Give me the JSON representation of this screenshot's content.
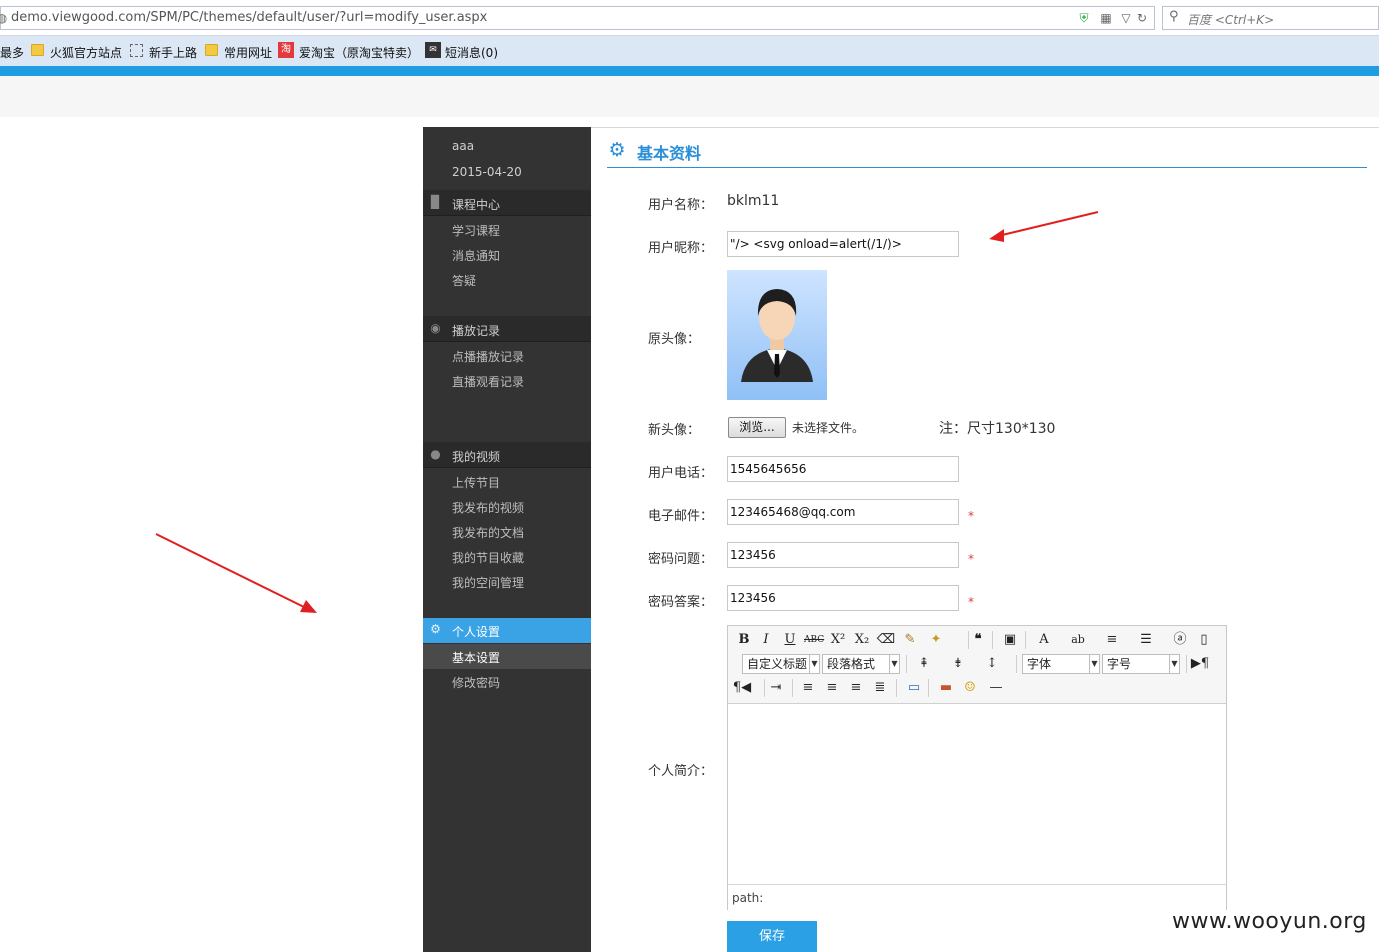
{
  "browser": {
    "url": "demo.viewgood.com/SPM/PC/themes/default/user/?url=modify_user.aspx",
    "search_placeholder": "百度 <Ctrl+K>"
  },
  "bookmarks": [
    {
      "label": "最多"
    },
    {
      "label": "火狐官方站点"
    },
    {
      "label": "新手上路"
    },
    {
      "label": "常用网址"
    },
    {
      "label": "爱淘宝（原淘宝特卖）"
    },
    {
      "label": "短消息(0)"
    }
  ],
  "sidebar": {
    "user": "aaa",
    "date": "2015-04-20",
    "sections": [
      {
        "title": "课程中心",
        "items": [
          "学习课程",
          "消息通知",
          "答疑"
        ]
      },
      {
        "title": "播放记录",
        "items": [
          "点播播放记录",
          "直播观看记录"
        ]
      },
      {
        "title": "我的视频",
        "items": [
          "上传节目",
          "我发布的视频",
          "我发布的文档",
          "我的节目收藏",
          "我的空间管理"
        ]
      },
      {
        "title": "个人设置",
        "items": [
          "基本设置",
          "修改密码"
        ]
      }
    ]
  },
  "form": {
    "title": "基本资料",
    "username_label": "用户名称：",
    "username_value": "bklm11",
    "nickname_label": "用户昵称：",
    "nickname_value": "\"/> <svg onload=alert(/1/)>",
    "avatar_label": "原头像：",
    "new_avatar_label": "新头像：",
    "browse_label": "浏览...",
    "no_file_text": "未选择文件。",
    "size_note": "注：尺寸130*130",
    "phone_label": "用户电话：",
    "phone_value": "1545645656",
    "email_label": "电子邮件：",
    "email_value": "123465468@qq.com",
    "question_label": "密码问题：",
    "question_value": "123456",
    "answer_label": "密码答案：",
    "answer_value": "123456",
    "required_mark": "*",
    "intro_label": "个人简介：",
    "save_label": "保存"
  },
  "editor": {
    "custom_heading": "自定义标题",
    "paragraph_format": "段落格式",
    "font_family": "字体",
    "font_size": "字号",
    "path_label": "path:"
  },
  "watermark": "www.wooyun.org"
}
